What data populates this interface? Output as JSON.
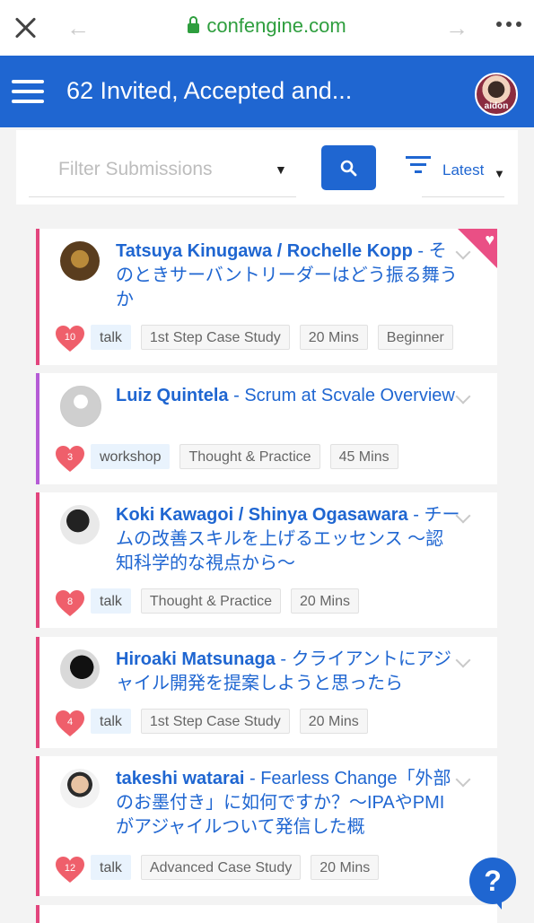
{
  "browser": {
    "url": "confengine.com"
  },
  "header": {
    "title": "62 Invited, Accepted and..."
  },
  "filter": {
    "placeholder": "Filter Submissions",
    "sort_label": "Latest"
  },
  "submissions": [
    {
      "speakers": "Tatsuya Kinugawa / Rochelle Kopp",
      "title": "- そのときサーバントリーダーはどう振る舞うか",
      "likes": "10",
      "type": "talk",
      "category": "1st Step Case Study",
      "duration": "20 Mins",
      "level": "Beginner"
    },
    {
      "speakers": "Luiz Quintela",
      "title": "- Scrum at Scvale Overview",
      "likes": "3",
      "type": "workshop",
      "category": "Thought & Practice",
      "duration": "45 Mins"
    },
    {
      "speakers": "Koki Kawagoi / Shinya Ogasawara",
      "title": "- チームの改善スキルを上げるエッセンス ～認知科学的な視点から～",
      "likes": "8",
      "type": "talk",
      "category": "Thought & Practice",
      "duration": "20 Mins"
    },
    {
      "speakers": "Hiroaki Matsunaga",
      "title": "- クライアントにアジャイル開発を提案しようと思ったら",
      "likes": "4",
      "type": "talk",
      "category": "1st Step Case Study",
      "duration": "20 Mins"
    },
    {
      "speakers": "takeshi watarai",
      "title": "- Fearless Change「外部のお墨付き」に如何ですか？～IPAやPMIがアジャイルついて発信した概",
      "likes": "12",
      "type": "talk",
      "category": "Advanced Case Study",
      "duration": "20 Mins"
    }
  ],
  "help": {
    "label": "?"
  },
  "colors": {
    "brand": "#1f66d1",
    "accent": "#e2457d",
    "url_green": "#2e9e3e"
  },
  "icons": [
    "close-icon",
    "back-arrow-icon",
    "forward-arrow-icon",
    "more-icon",
    "lock-icon",
    "menu-icon",
    "search-icon",
    "sort-icon",
    "heart-icon",
    "chevron-down-icon",
    "help-icon"
  ]
}
